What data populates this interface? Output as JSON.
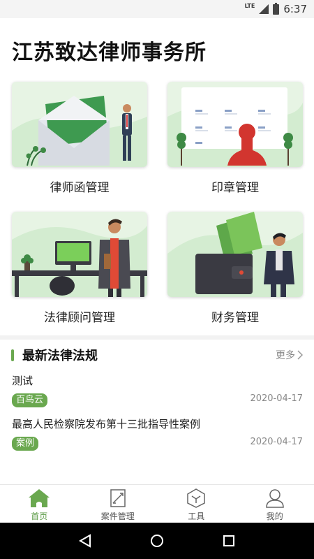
{
  "status_bar": {
    "network": "LTE",
    "time": "6:37"
  },
  "app": {
    "title": "江苏致达律师事务所"
  },
  "cards": [
    {
      "label": "律师函管理",
      "icon": "envelope-lawyer-illustration"
    },
    {
      "label": "印章管理",
      "icon": "seal-stamp-illustration"
    },
    {
      "label": "法律顾问管理",
      "icon": "advisor-phone-illustration"
    },
    {
      "label": "财务管理",
      "icon": "wallet-money-illustration"
    }
  ],
  "news": {
    "title": "最新法律法规",
    "more_label": "更多",
    "items": [
      {
        "title": "测试",
        "tag": "百鸟云",
        "date": "2020-04-17"
      },
      {
        "title": "最高人民检察院发布第十三批指导性案例",
        "tag": "案例",
        "date": "2020-04-17"
      }
    ]
  },
  "tabs": [
    {
      "label": "首页",
      "icon": "home-icon",
      "active": true
    },
    {
      "label": "案件管理",
      "icon": "case-edit-icon",
      "active": false
    },
    {
      "label": "工具",
      "icon": "toolbox-icon",
      "active": false
    },
    {
      "label": "我的",
      "icon": "user-icon",
      "active": false
    }
  ],
  "colors": {
    "accent": "#6aa84f",
    "card_bg": "#e7f4e4",
    "nav_bar": "#000000"
  }
}
